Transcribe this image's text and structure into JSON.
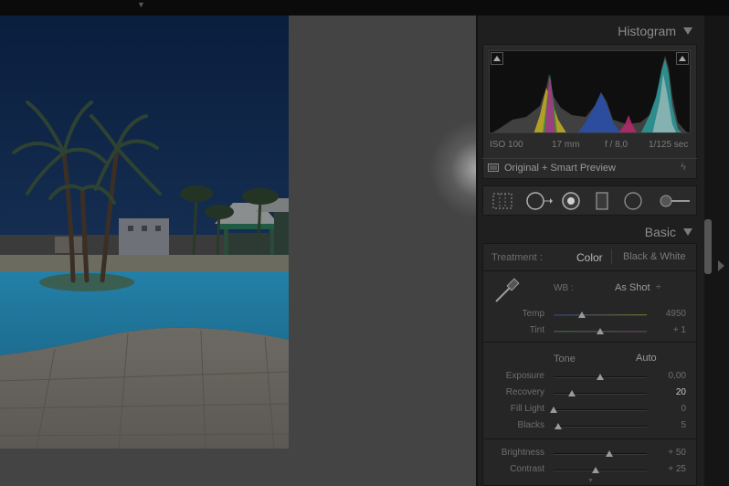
{
  "histogram": {
    "title": "Histogram",
    "exif": {
      "iso": "ISO 100",
      "focal": "17 mm",
      "aperture": "f / 8,0",
      "shutter": "1/125 sec"
    },
    "preview_label": "Original + Smart Preview"
  },
  "basic": {
    "title": "Basic",
    "treatment_label": "Treatment :",
    "treatment_color": "Color",
    "treatment_bw": "Black & White",
    "wb_label": "WB :",
    "wb_value": "As Shot",
    "wb_arrows": "÷",
    "sliders_wb": [
      {
        "label": "Temp",
        "value": "4950",
        "level": 0.3
      },
      {
        "label": "Tint",
        "value": "+ 1",
        "level": 0.5
      }
    ],
    "tone_label": "Tone",
    "auto_label": "Auto",
    "sliders_tone": [
      {
        "label": "Exposure",
        "value": "0,00",
        "level": 0.5
      },
      {
        "label": "Recovery",
        "value": "20",
        "level": 0.2
      },
      {
        "label": "Fill Light",
        "value": "0",
        "level": 0.0
      },
      {
        "label": "Blacks",
        "value": "5",
        "level": 0.05
      }
    ],
    "sliders_presence": [
      {
        "label": "Brightness",
        "value": "+ 50",
        "level": 0.6
      },
      {
        "label": "Contrast",
        "value": "+ 25",
        "level": 0.45
      }
    ]
  },
  "icons": {
    "collapse": "triangle-down-icon",
    "crop": "crop-overlay-icon",
    "spot": "spot-removal-icon",
    "redeye": "red-eye-correction-icon",
    "graduated": "graduated-filter-icon",
    "radial": "radial-filter-icon",
    "brush": "adjustment-brush-icon",
    "eyedropper": "white-balance-selector-icon"
  },
  "colors": {
    "panel_bg": "#1f1f1f",
    "canvas_bg": "#444444",
    "text": "#9a9a9a",
    "sky": "#0c2a4f",
    "pool": "#2a90b6"
  }
}
